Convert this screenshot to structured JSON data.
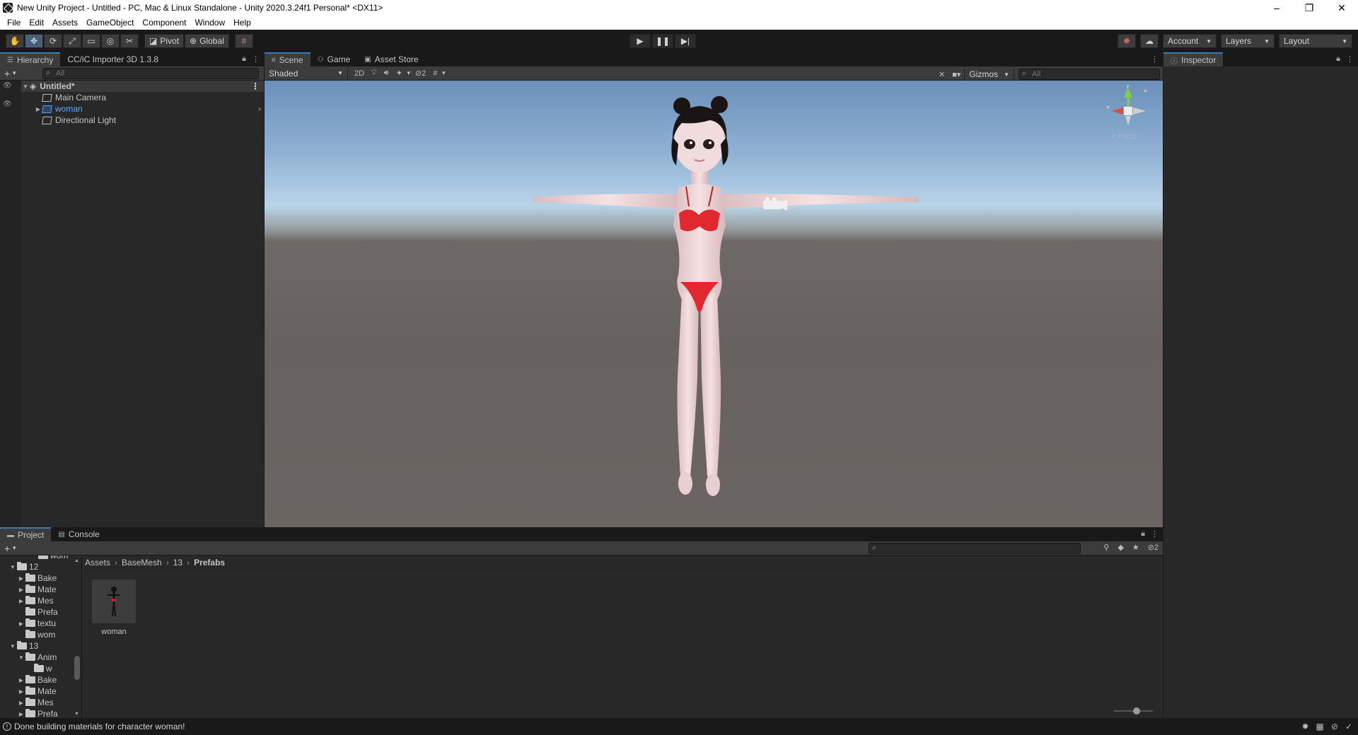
{
  "window": {
    "title": "New Unity Project - Untitled - PC, Mac & Linux Standalone - Unity 2020.3.24f1 Personal* <DX11>",
    "controls": [
      "–",
      "❐",
      "✕"
    ]
  },
  "menu": [
    "File",
    "Edit",
    "Assets",
    "GameObject",
    "Component",
    "Window",
    "Help"
  ],
  "toolbar": {
    "tools": [
      "hand-icon",
      "move-icon",
      "rotate-icon",
      "scale-icon",
      "rect-icon",
      "transform-icon",
      "custom-tool-icon"
    ],
    "pivot_label": "Pivot",
    "global_label": "Global",
    "account_label": "Account",
    "layers_label": "Layers",
    "layout_label": "Layout"
  },
  "hierarchy": {
    "tabs": [
      "Hierarchy",
      "CC/iC Importer 3D 1.3.8"
    ],
    "search_placeholder": "All",
    "scene_name": "Untitled*",
    "items": [
      {
        "label": "Main Camera",
        "color": "#c4c4c4"
      },
      {
        "label": "woman",
        "color": "#5aa8ff"
      },
      {
        "label": "Directional Light",
        "color": "#c4c4c4"
      }
    ]
  },
  "scene": {
    "tabs": [
      "Scene",
      "Game",
      "Asset Store"
    ],
    "shading_mode": "Shaded",
    "mode_2d": "2D",
    "hidden_count": "2",
    "gizmos_label": "Gizmos",
    "search_placeholder": "All",
    "persp_label": "Persp",
    "colors": {
      "swimsuit": "#e0282e",
      "skin": "#f0d6d6",
      "hair": "#1a1414"
    }
  },
  "project": {
    "tabs": [
      "Project",
      "Console"
    ],
    "visible_count": "2",
    "tree": [
      {
        "label": "wom",
        "indent": 3,
        "arrow": ""
      },
      {
        "label": "12",
        "indent": 1,
        "arrow": "▼"
      },
      {
        "label": "Bake",
        "indent": 2,
        "arrow": "▶"
      },
      {
        "label": "Mate",
        "indent": 2,
        "arrow": "▶"
      },
      {
        "label": "Mes",
        "indent": 2,
        "arrow": "▶"
      },
      {
        "label": "Prefa",
        "indent": 2,
        "arrow": ""
      },
      {
        "label": "textu",
        "indent": 2,
        "arrow": "▶"
      },
      {
        "label": "wom",
        "indent": 2,
        "arrow": ""
      },
      {
        "label": "13",
        "indent": 1,
        "arrow": "▼"
      },
      {
        "label": "Anim",
        "indent": 2,
        "arrow": "▼"
      },
      {
        "label": "w",
        "indent": 3,
        "arrow": ""
      },
      {
        "label": "Bake",
        "indent": 2,
        "arrow": "▶"
      },
      {
        "label": "Mate",
        "indent": 2,
        "arrow": "▶"
      },
      {
        "label": "Mes",
        "indent": 2,
        "arrow": "▶"
      },
      {
        "label": "Prefa",
        "indent": 2,
        "arrow": "▶"
      }
    ],
    "breadcrumb": [
      "Assets",
      "BaseMesh",
      "13",
      "Prefabs"
    ],
    "assets": [
      {
        "label": "woman"
      }
    ]
  },
  "inspector": {
    "tab": "Inspector"
  },
  "status": {
    "message": "Done building materials for character woman!"
  }
}
